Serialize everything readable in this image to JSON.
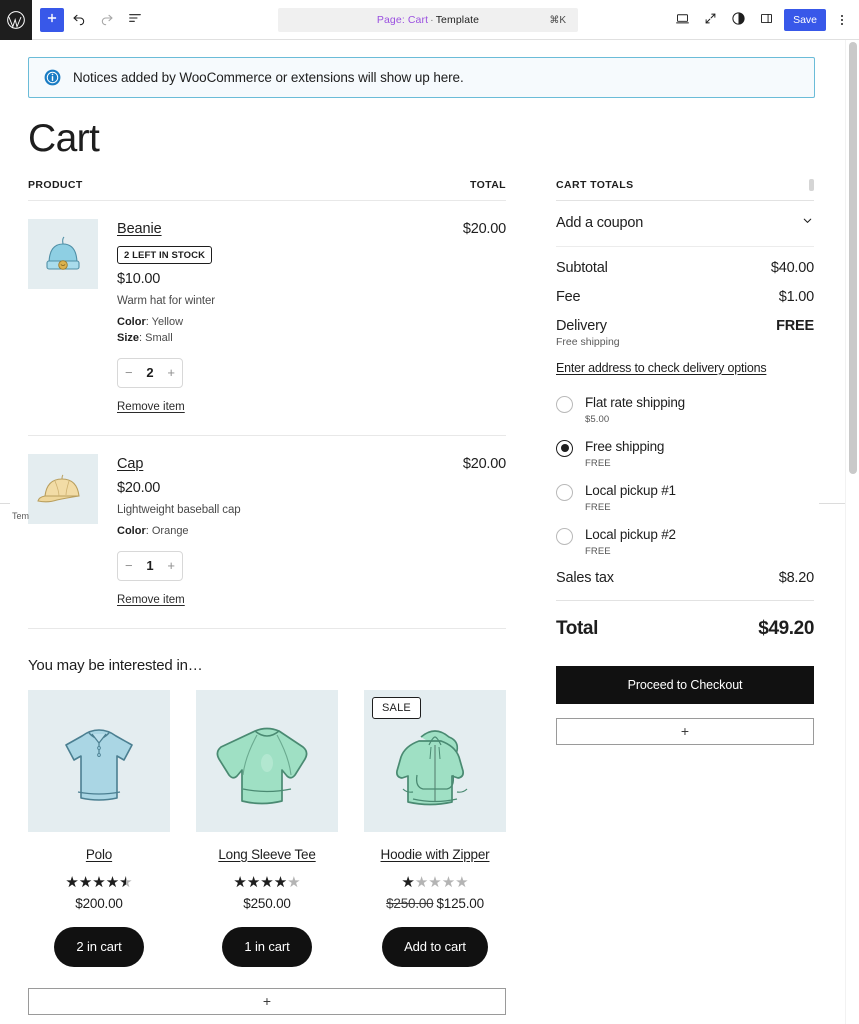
{
  "toolbar": {
    "logo_icon": "wordpress-logo-icon",
    "add_block_label": "+",
    "add_block_icon": "plus-icon",
    "undo_icon": "undo-icon",
    "redo_icon": "redo-icon",
    "list_view_icon": "document-overview-icon",
    "title_prefix": "Page: Cart",
    "title_separator": "·",
    "title_suffix": "Template",
    "command_hint": "⌘K",
    "view_icon": "desktop-view-icon",
    "zoom_icon": "zoom-out-icon",
    "styles_icon": "contrast-styles-icon",
    "sidebar_icon": "settings-sidebar-icon",
    "save_label": "Save",
    "options_icon": "kebab-menu-icon",
    "accent_color": "#3858e9"
  },
  "notice": {
    "icon": "info-icon",
    "text": "Notices added by WooCommerce or extensions will show up here.",
    "border_color": "#6bbcd8",
    "background_color": "#f6fafd"
  },
  "page": {
    "title": "Cart",
    "edge_label": "Tem"
  },
  "items_table": {
    "header_product": "PRODUCT",
    "header_total": "TOTAL",
    "rows": [
      {
        "name": "Beanie",
        "image_icon": "beanie-product-image",
        "stock_badge": "2 LEFT IN STOCK",
        "unit_price": "$10.00",
        "description": "Warm hat for winter",
        "variations": [
          {
            "label": "Color",
            "value": "Yellow"
          },
          {
            "label": "Size",
            "value": "Small"
          }
        ],
        "quantity": "2",
        "decrease_label": "−",
        "increase_label": "+",
        "remove_label": "Remove item",
        "line_total": "$20.00"
      },
      {
        "name": "Cap",
        "image_icon": "cap-product-image",
        "stock_badge": "",
        "unit_price": "$20.00",
        "description": "Lightweight baseball cap",
        "variations": [
          {
            "label": "Color",
            "value": "Orange"
          }
        ],
        "quantity": "1",
        "decrease_label": "−",
        "increase_label": "+",
        "remove_label": "Remove item",
        "line_total": "$20.00"
      }
    ]
  },
  "cross_sells": {
    "title": "You may be interested in…",
    "add_block_label": "+",
    "products": [
      {
        "name": "Polo",
        "image_icon": "polo-shirt-image",
        "rating": 4.5,
        "price": "$200.00",
        "regular_price": "",
        "sale_badge": "",
        "button_label": "2 in cart"
      },
      {
        "name": "Long Sleeve Tee",
        "image_icon": "long-sleeve-tee-image",
        "rating": 4,
        "price": "$250.00",
        "regular_price": "",
        "sale_badge": "",
        "button_label": "1 in cart"
      },
      {
        "name": "Hoodie with Zipper",
        "image_icon": "hoodie-with-zipper-image",
        "rating": 1,
        "price": "$125.00",
        "regular_price": "$250.00",
        "sale_badge": "SALE",
        "button_label": "Add to cart"
      }
    ]
  },
  "cart_totals": {
    "heading": "CART TOTALS",
    "drag_handle_icon": "drag-handle-icon",
    "coupon_label": "Add a coupon",
    "coupon_chevron_icon": "chevron-down-icon",
    "subtotal_label": "Subtotal",
    "subtotal_value": "$40.00",
    "fee_label": "Fee",
    "fee_value": "$1.00",
    "delivery_label": "Delivery",
    "delivery_value": "FREE",
    "delivery_note": "Free shipping",
    "address_link": "Enter address to check delivery options",
    "shipping_options": [
      {
        "name": "Flat rate shipping",
        "cost": "$5.00",
        "selected": false
      },
      {
        "name": "Free shipping",
        "cost": "FREE",
        "selected": true
      },
      {
        "name": "Local pickup #1",
        "cost": "FREE",
        "selected": false
      },
      {
        "name": "Local pickup #2",
        "cost": "FREE",
        "selected": false
      }
    ],
    "tax_label": "Sales tax",
    "tax_value": "$8.20",
    "total_label": "Total",
    "total_value": "$49.20",
    "checkout_label": "Proceed to Checkout",
    "add_block_label": "+"
  }
}
